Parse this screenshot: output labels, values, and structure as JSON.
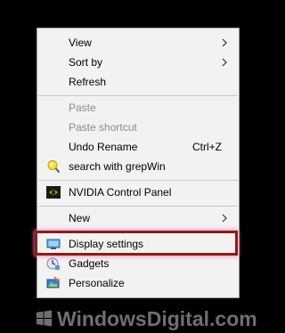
{
  "context_menu": {
    "group_1": {
      "view": "View",
      "sort_by": "Sort by",
      "refresh": "Refresh"
    },
    "group_2": {
      "paste": "Paste",
      "paste_shortcut": "Paste shortcut",
      "undo_rename": "Undo Rename",
      "undo_rename_shortcut": "Ctrl+Z",
      "search_grepwin": "search with grepWin"
    },
    "group_3": {
      "nvidia": "NVIDIA Control Panel"
    },
    "group_4": {
      "new": "New"
    },
    "group_5": {
      "display_settings": "Display settings",
      "gadgets": "Gadgets",
      "personalize": "Personalize"
    },
    "highlighted_item": "Display settings",
    "highlight_color": "#8f1c10"
  },
  "watermark": {
    "text": "WindowsDigital.com"
  }
}
